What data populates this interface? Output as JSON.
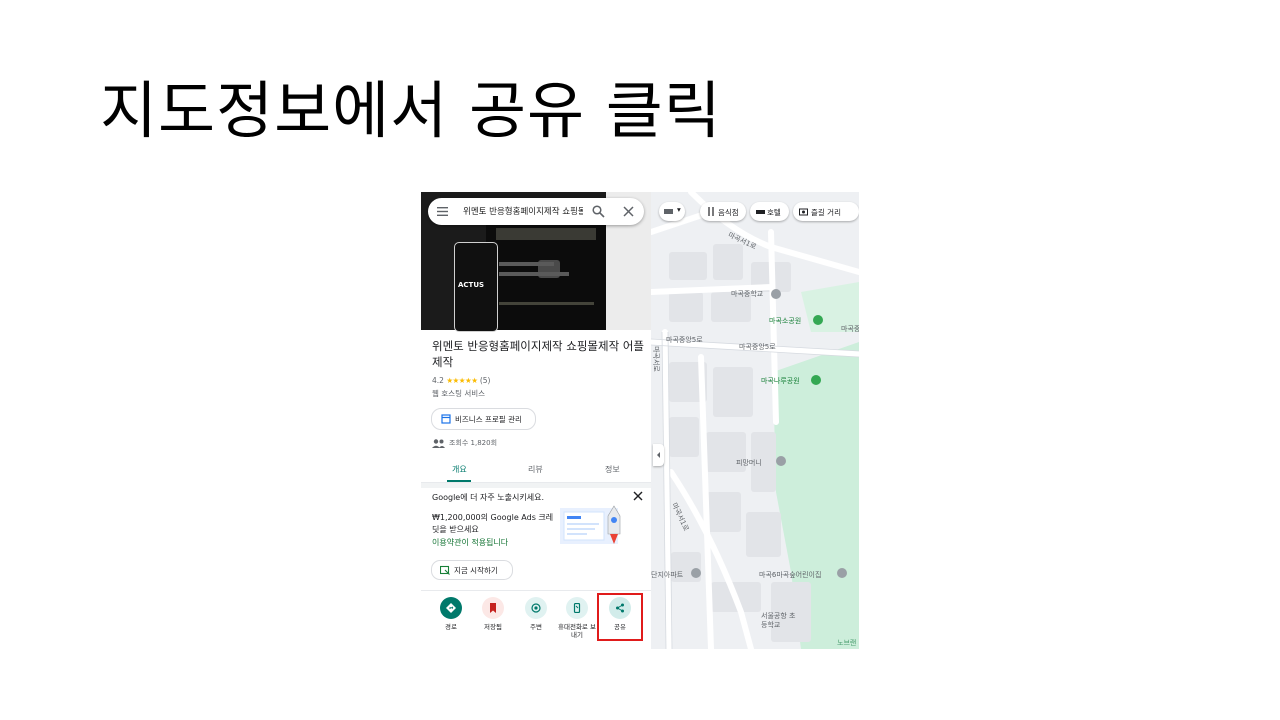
{
  "slide": {
    "title": "지도정보에서 공유 클릭"
  },
  "search": {
    "query": "위멘토 반응형홈페이지제작 쇼핑몰"
  },
  "hero": {
    "logo_text": "ACTUS"
  },
  "place": {
    "name": "위멘토 반응형홈페이지제작 쇼핑몰제작 어플제작",
    "rating": "4.2",
    "stars": "★★★★★",
    "review_count": "(5)",
    "category": "웹 호스팅 서비스",
    "manage_button": "비즈니스 프로필 관리",
    "views": "조회수 1,820회"
  },
  "tabs": {
    "overview": "개요",
    "reviews": "리뷰",
    "about": "정보"
  },
  "promo": {
    "title": "Google에 더 자주 노출시키세요.",
    "body": "₩1,200,000의 Google Ads 크레딧을 받으세요",
    "terms_link": "이용약관이 적용됩니다",
    "start_button": "지금 시작하기"
  },
  "actions": {
    "directions": "경로",
    "save": "저장됨",
    "nearby": "주변",
    "send_to_phone": "휴대전화로 보내기",
    "share": "공유"
  },
  "map": {
    "chips": {
      "restaurants": "음식점",
      "hotels": "호텔",
      "things_to_do": "즐길 거리"
    },
    "labels": {
      "road1": "마곡서1로",
      "road2": "마곡중앙5로",
      "road3": "마곡중앙5로",
      "road4": "마곡서1로",
      "road5": "마곡서로",
      "school1": "마곡중학교",
      "park1": "마곡소공원",
      "park2": "마곡나루공원",
      "poi1": "피망머니",
      "apt": "단지아파트",
      "kinder": "마곡6마곡숲어린이집",
      "school2": "서울공항 초등학교",
      "corner": "노브랜",
      "right_edge": "마곡중"
    },
    "colors": {
      "park": "#c8ecd4",
      "road": "#ffffff",
      "block": "#e4e6ea"
    }
  },
  "colors": {
    "accent": "#00796b",
    "highlight": "#e01b1b"
  }
}
